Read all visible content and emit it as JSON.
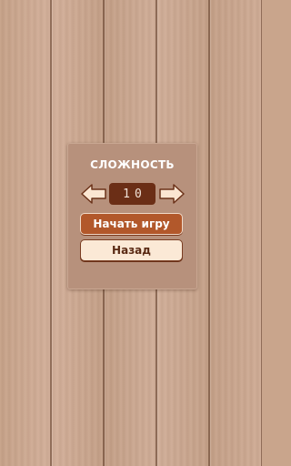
{
  "dialog": {
    "title": "СЛОЖНОСТЬ",
    "level": "10",
    "start_label": "Начать игру",
    "back_label": "Назад"
  },
  "icons": {
    "left": "arrow-left-icon",
    "right": "arrow-right-icon"
  },
  "colors": {
    "panel": "#b7917c",
    "level_bg": "#6b2e16",
    "start_button": "#b2582b",
    "back_button": "#fbe9d6"
  }
}
